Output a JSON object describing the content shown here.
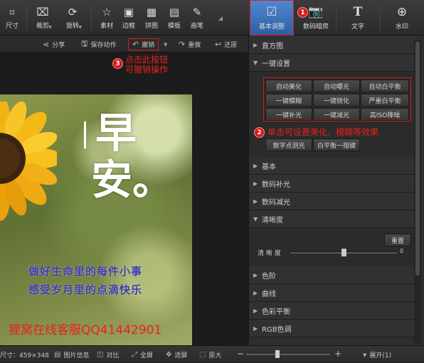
{
  "toolbar": {
    "tools": [
      {
        "label": "尺寸",
        "icon": "crop-size-icon"
      },
      {
        "label": "裁剪",
        "icon": "crop-icon"
      },
      {
        "label": "旋转",
        "icon": "rotate-icon"
      },
      {
        "label": "素材",
        "icon": "star-icon"
      },
      {
        "label": "边框",
        "icon": "frame-icon"
      },
      {
        "label": "拼图",
        "icon": "collage-icon"
      },
      {
        "label": "模板",
        "icon": "template-icon"
      },
      {
        "label": "画笔",
        "icon": "brush-icon"
      }
    ],
    "tabs": [
      {
        "label": "基本调整",
        "icon": "adjust-icon",
        "active": true
      },
      {
        "label": "数码暗房",
        "icon": "camera-icon",
        "active": false
      },
      {
        "label": "文字",
        "icon": "text-icon",
        "active": false
      },
      {
        "label": "水印",
        "icon": "watermark-icon",
        "active": false
      }
    ]
  },
  "subbar": {
    "share": "分享",
    "save_action": "保存动作",
    "undo": "撤销",
    "redo": "重做",
    "restore": "还原"
  },
  "photo": {
    "big1": "早",
    "big2": "安。",
    "line1": "做好生命里的每件小事",
    "line2": "感受岁月里的点滴快乐"
  },
  "annotations": {
    "badge1": "1",
    "badge2": "2",
    "badge3": "3",
    "note2": "单击可设置美化、模糊等效果",
    "note3_line1": "点击此按钮",
    "note3_line2": "可撤销操作",
    "watermark": "狸窝在线客服QQ41442901"
  },
  "panel": {
    "histogram": "直方图",
    "onekey": "一键设置",
    "onekey_buttons": [
      "自动美化",
      "自动曝光",
      "自动白平衡",
      "一键模糊",
      "一键锐化",
      "严重白平衡",
      "一键补光",
      "一键减光",
      "高ISO降噪",
      "数字点测光",
      "白平衡一指键"
    ],
    "basic": "基本",
    "digital_fill": "数码补光",
    "digital_reduce": "数码减光",
    "sharpness": "清晰度",
    "reset": "重置",
    "sharpness_label": "清 晰 度",
    "sharpness_value": "0",
    "sharpness_level": 0.5,
    "levels": "色阶",
    "curves": "曲线",
    "color_balance": "色彩平衡",
    "rgb_tone": "RGB色调"
  },
  "status": {
    "size": "尺寸：459×348",
    "info": "图片信息",
    "compare": "对比",
    "fullscreen": "全屏",
    "fit": "适屏",
    "original": "原大",
    "zoom_minus": "−",
    "zoom_plus": "+",
    "expand": "展开(1)",
    "zoom_level": 0.37
  }
}
